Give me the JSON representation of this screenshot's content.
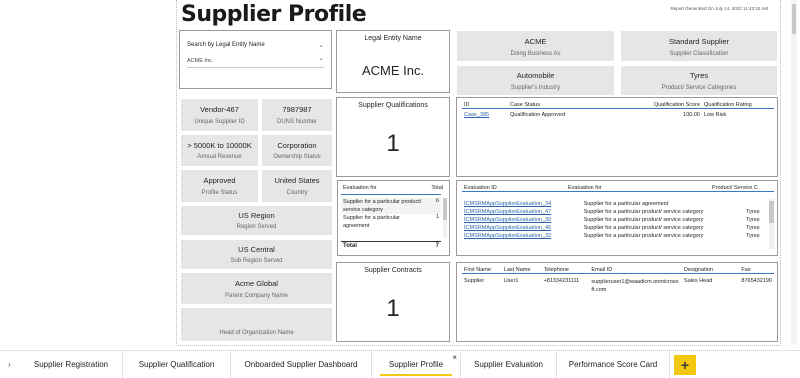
{
  "report": {
    "title": "Supplier Profile",
    "generated": "Report Generated On July 14, 2022 11:43:10 AM"
  },
  "slicer": {
    "title": "Search by Legal Entity Name",
    "value": "ACME Inc."
  },
  "legal_entity": {
    "label": "Legal Entity Name",
    "value": "ACME Inc."
  },
  "top_cards": [
    {
      "value": "ACME",
      "label": "Doing Business As"
    },
    {
      "value": "Standard Supplier",
      "label": "Supplier Classification"
    },
    {
      "value": "Automobile",
      "label": "Supplier's Industry"
    },
    {
      "value": "Tyres",
      "label": "Product/ Service Categories"
    }
  ],
  "left_cards": [
    {
      "value": "Vendor-467",
      "label": "Unique Supplier ID"
    },
    {
      "value": "7987987",
      "label": "DUNS Number"
    },
    {
      "value": "> 5000K to 10000K",
      "label": "Annual Revenue"
    },
    {
      "value": "Corporation",
      "label": "Ownership Status"
    },
    {
      "value": "Approved",
      "label": "Profile Status"
    },
    {
      "value": "United States",
      "label": "Country"
    },
    {
      "value": "US Region",
      "label": "Region Served"
    },
    {
      "value": "US Central",
      "label": "Sub Region Served"
    },
    {
      "value": "Acme Global",
      "label": "Parent Company Name"
    },
    {
      "value": "",
      "label": "Head of Organization Name"
    }
  ],
  "qualifications": {
    "label": "Supplier Qualifications",
    "value": "1"
  },
  "contracts": {
    "label": "Supplier Contracts",
    "value": "1"
  },
  "cases_table": {
    "headers": [
      "ID",
      "Case Status",
      "Qualification Score",
      "Qualification Rating"
    ],
    "rows": [
      [
        "Case_385",
        "Qualification Approved",
        "100.00",
        "Low Risk"
      ]
    ]
  },
  "eval_small": {
    "headers": [
      "Evaluation for",
      "Total"
    ],
    "rows": [
      [
        "Supplier for a particular product/ service category",
        "6"
      ],
      [
        "Supplier for a particular agreement",
        "1"
      ]
    ],
    "total_label": "Total",
    "total_value": "7"
  },
  "eval_table": {
    "headers": [
      "Evaluation ID",
      "Evaluation for",
      "Product/ Service C"
    ],
    "rows": [
      [
        "ICMSRMAppSupplierEvaluation_34",
        "Supplier for a particular agreement",
        ""
      ],
      [
        "ICMSRMAppSupplierEvaluation_47",
        "Supplier for a particular product/ service category",
        "Tyres"
      ],
      [
        "ICMSRMAppSupplierEvaluation_30",
        "Supplier for a particular product/ service category",
        "Tyres"
      ],
      [
        "ICMSRMAppSupplierEvaluation_46",
        "Supplier for a particular product/ service category",
        "Tyres"
      ],
      [
        "ICMSRMAppSupplierEvaluation_32",
        "Supplier for a particular product/ service category",
        "Tyres"
      ]
    ]
  },
  "contacts_table": {
    "headers": [
      "First Name",
      "Last Name",
      "Telephone",
      "Email ID",
      "Designation",
      "Fax"
    ],
    "rows": [
      [
        "Supplier",
        "User1",
        "+81334231111",
        "supplieruser1@waadicm.onmicrosoft.com",
        "Sales Head",
        "8765432190"
      ]
    ]
  },
  "tabs": [
    {
      "label": "Supplier Registration"
    },
    {
      "label": "Supplier Qualification"
    },
    {
      "label": "Onboarded Supplier Dashboard"
    },
    {
      "label": "Supplier Profile",
      "active": true
    },
    {
      "label": "Supplier Evaluation"
    },
    {
      "label": "Performance Score Card"
    }
  ],
  "tab_close": "×",
  "tab_add": "+",
  "tab_nav": "›",
  "colors": {
    "accent": "#f2c811",
    "link": "#2d64ad",
    "card_bg": "#e6e6e6",
    "header_line": "#3a78c2"
  }
}
